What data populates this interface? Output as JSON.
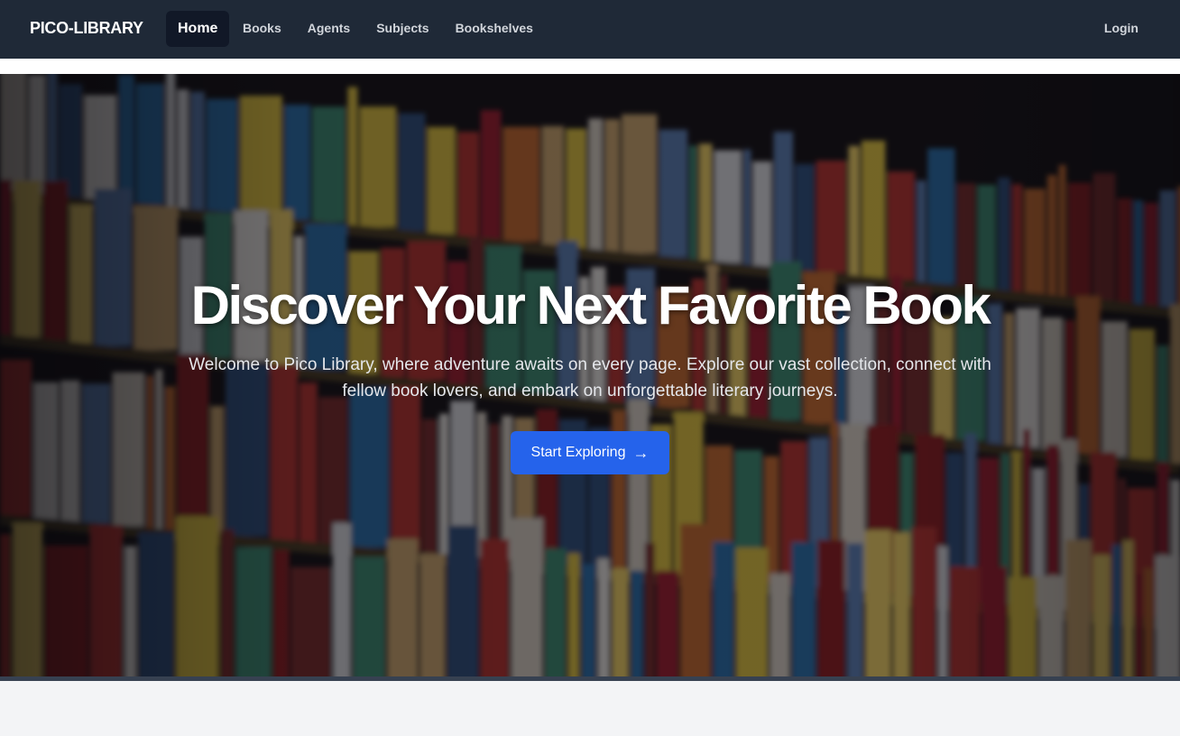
{
  "nav": {
    "brand": "PICO-LIBRARY",
    "links": [
      {
        "label": "Home",
        "active": true
      },
      {
        "label": "Books"
      },
      {
        "label": "Agents"
      },
      {
        "label": "Subjects"
      },
      {
        "label": "Bookshelves"
      }
    ],
    "login": "Login"
  },
  "hero": {
    "title": "Discover Your Next Favorite Book",
    "subtitle": "Welcome to Pico Library, where adventure awaits on every page. Explore our vast collection, connect with fellow book lovers, and embark on unforgettable literary journeys.",
    "cta_label": "Start Exploring",
    "cta_icon": "arrow-right-icon",
    "background": "bookshelf-photo"
  },
  "colors": {
    "navbar": "#1f2937",
    "nav_active": "#111827",
    "accent": "#2563eb",
    "page_bg": "#f3f4f6"
  }
}
